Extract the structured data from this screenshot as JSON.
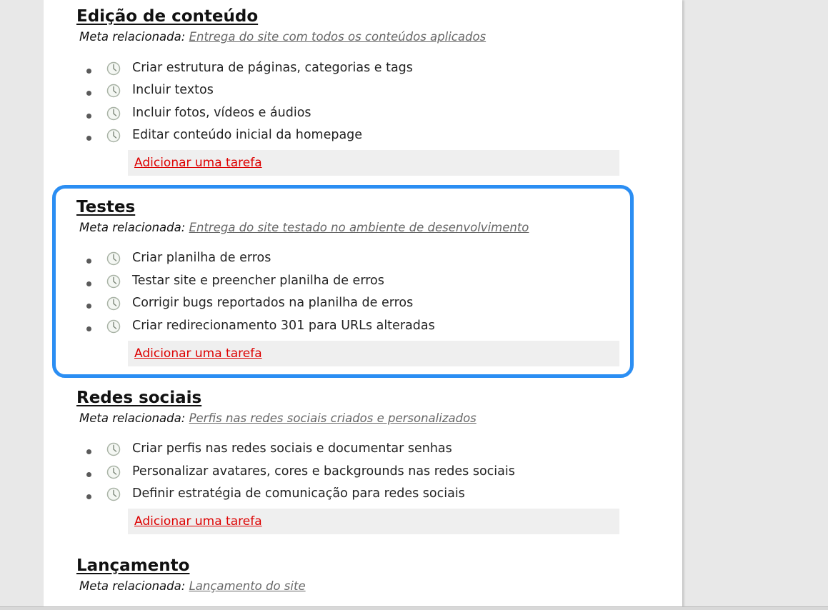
{
  "sections": [
    {
      "title": "Edição de conteúdo",
      "goal_label": "Meta relacionada:",
      "goal_link": "Entrega do site com todos os conteúdos aplicados",
      "tasks": [
        "Criar estrutura de páginas, categorias e tags",
        "Incluir textos",
        "Incluir fotos, vídeos e áudios",
        "Editar conteúdo inicial da homepage"
      ],
      "add_task": "Adicionar uma tarefa"
    },
    {
      "title": "Testes",
      "goal_label": "Meta relacionada:",
      "goal_link": "Entrega do site testado no ambiente de desenvolvimento",
      "tasks": [
        "Criar planilha de erros",
        "Testar site e preencher planilha de erros",
        "Corrigir bugs reportados na planilha de erros",
        "Criar redirecionamento 301 para URLs alteradas"
      ],
      "add_task": "Adicionar uma tarefa"
    },
    {
      "title": "Redes sociais",
      "goal_label": "Meta relacionada:",
      "goal_link": "Perfis nas redes sociais criados e personalizados",
      "tasks": [
        "Criar perfis nas redes sociais e documentar senhas",
        "Personalizar avatares, cores e backgrounds nas redes sociais",
        "Definir estratégia de comunicação para redes sociais"
      ],
      "add_task": "Adicionar uma tarefa"
    },
    {
      "title": "Lançamento",
      "goal_label": "Meta relacionada:",
      "goal_link": "Lançamento do site",
      "tasks": [],
      "add_task": ""
    }
  ],
  "task_icon": "clock-icon",
  "highlighted_section": "Testes",
  "colors": {
    "highlight_border": "#2b8ef3",
    "add_link": "#dd0000",
    "add_box_bg": "#efefef",
    "goal_link": "#666666"
  }
}
